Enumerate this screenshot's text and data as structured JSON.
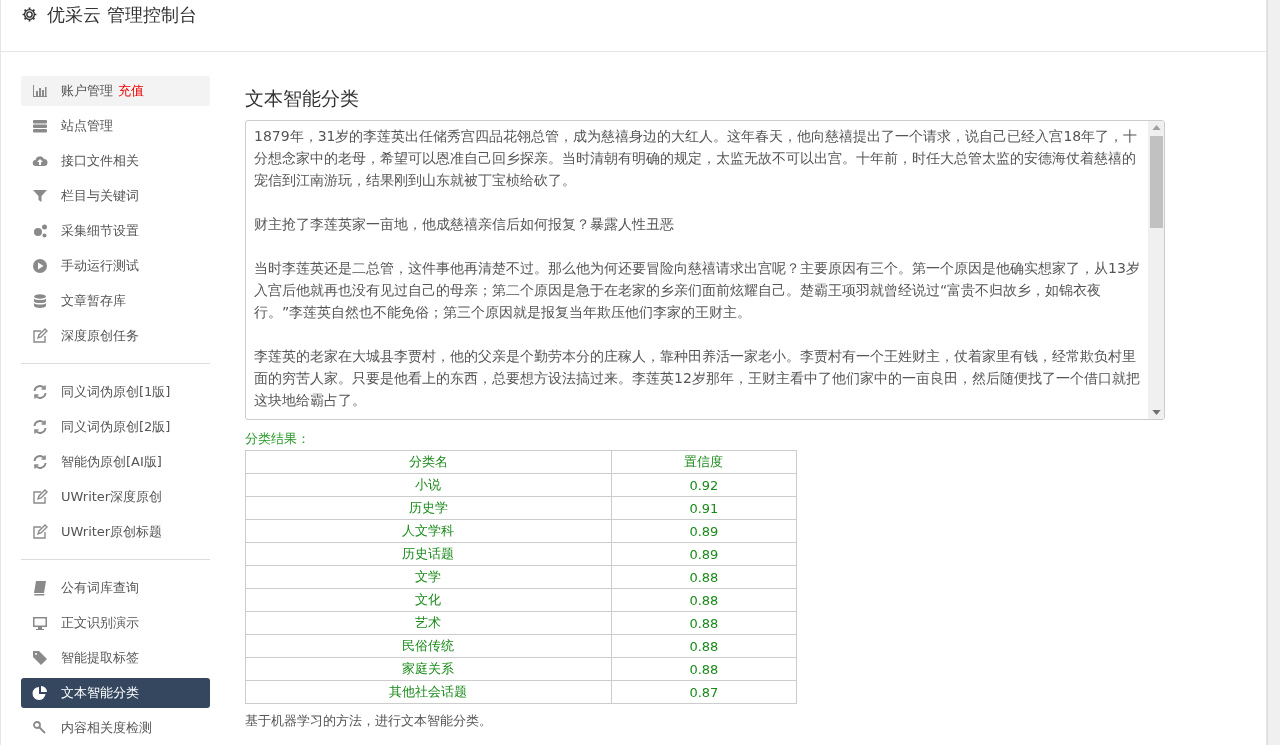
{
  "header": {
    "title": "优采云 管理控制台"
  },
  "sidebar": {
    "groups": [
      [
        {
          "label": "账户管理",
          "badge": "充值",
          "hovered": true,
          "selected": false
        },
        {
          "label": "站点管理",
          "hovered": false,
          "selected": false
        },
        {
          "label": "接口文件相关",
          "hovered": false,
          "selected": false
        },
        {
          "label": "栏目与关键词",
          "hovered": false,
          "selected": false
        },
        {
          "label": "采集细节设置",
          "hovered": false,
          "selected": false
        },
        {
          "label": "手动运行测试",
          "hovered": false,
          "selected": false
        },
        {
          "label": "文章暂存库",
          "hovered": false,
          "selected": false
        },
        {
          "label": "深度原创任务",
          "hovered": false,
          "selected": false
        }
      ],
      [
        {
          "label": "同义词伪原创[1版]",
          "hovered": false,
          "selected": false
        },
        {
          "label": "同义词伪原创[2版]",
          "hovered": false,
          "selected": false
        },
        {
          "label": "智能伪原创[AI版]",
          "hovered": false,
          "selected": false
        },
        {
          "label": "UWriter深度原创",
          "hovered": false,
          "selected": false
        },
        {
          "label": "UWriter原创标题",
          "hovered": false,
          "selected": false
        }
      ],
      [
        {
          "label": "公有词库查询",
          "hovered": false,
          "selected": false
        },
        {
          "label": "正文识别演示",
          "hovered": false,
          "selected": false
        },
        {
          "label": "智能提取标签",
          "hovered": false,
          "selected": false
        },
        {
          "label": "文本智能分类",
          "hovered": false,
          "selected": true
        },
        {
          "label": "内容相关度检测",
          "hovered": false,
          "selected": false
        }
      ]
    ]
  },
  "main": {
    "title": "文本智能分类",
    "text_input": {
      "paragraphs": [
        "1879年，31岁的李莲英出任储秀宫四品花翎总管，成为慈禧身边的大红人。这年春天，他向慈禧提出了一个请求，说自己已经入宫18年了，十分想念家中的老母，希望可以恩准自己回乡探亲。当时清朝有明确的规定，太监无故不可以出宫。十年前，时任大总管太监的安德海仗着慈禧的宠信到江南游玩，结果刚到山东就被丁宝桢给砍了。",
        "财主抢了李莲英家一亩地，他成慈禧亲信后如何报复？暴露人性丑恶",
        "当时李莲英还是二总管，这件事他再清楚不过。那么他为何还要冒险向慈禧请求出宫呢？主要原因有三个。第一个原因是他确实想家了，从13岁入宫后他就再也没有见过自己的母亲；第二个原因是急于在老家的乡亲们面前炫耀自己。楚霸王项羽就曾经说过“富贵不归故乡，如锦衣夜行。”李莲英自然也不能免俗；第三个原因就是报复当年欺压他们李家的王财主。",
        "李莲英的老家在大城县李贾村，他的父亲是个勤劳本分的庄稼人，靠种田养活一家老小。李贾村有一个王姓财主，仗着家里有钱，经常欺负村里面的穷苦人家。只要是他看上的东西，总要想方设法搞过来。李莲英12岁那年，王财主看中了他们家中的一亩良田，然后随便找了一个借口就把这块地给霸占了。"
      ]
    },
    "result_label": "分类结果：",
    "table": {
      "columns": [
        "分类名",
        "置信度"
      ],
      "rows": [
        [
          "小说",
          "0.92"
        ],
        [
          "历史学",
          "0.91"
        ],
        [
          "人文学科",
          "0.89"
        ],
        [
          "历史话题",
          "0.89"
        ],
        [
          "文学",
          "0.88"
        ],
        [
          "文化",
          "0.88"
        ],
        [
          "艺术",
          "0.88"
        ],
        [
          "民俗传统",
          "0.88"
        ],
        [
          "家庭关系",
          "0.88"
        ],
        [
          "其他社会话题",
          "0.87"
        ]
      ]
    },
    "footnote": "基于机器学习的方法，进行文本智能分类。"
  }
}
